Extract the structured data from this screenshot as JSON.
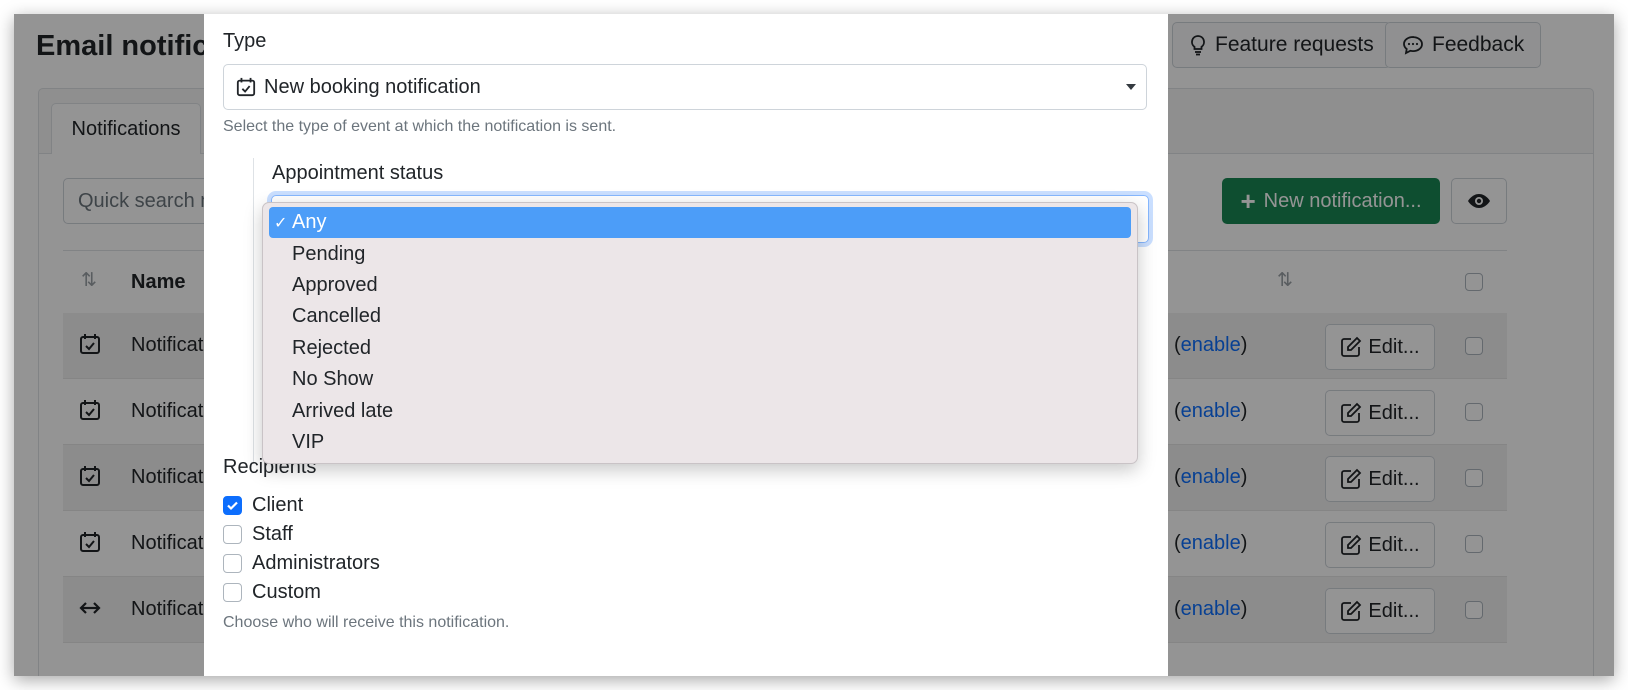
{
  "page": {
    "title": "Email notificat",
    "header_buttons": {
      "feature_requests": "Feature requests",
      "feedback": "Feedback"
    },
    "tabs": [
      {
        "label": "Notifications"
      }
    ],
    "search_placeholder": "Quick search n",
    "new_notification_label": "New notification...",
    "table": {
      "name_header": "Name",
      "rows": [
        {
          "name": "Notificat",
          "icon": "calendar-check-icon",
          "action_open": "(",
          "action_link": "enable",
          "action_close": ")",
          "edit_label": "Edit..."
        },
        {
          "name": "Notificat",
          "icon": "calendar-check-icon",
          "action_open": "(",
          "action_link": "enable",
          "action_close": ")",
          "edit_label": "Edit..."
        },
        {
          "name": "Notificat",
          "icon": "calendar-check-icon",
          "action_open": "(",
          "action_link": "enable",
          "action_close": ")",
          "edit_label": "Edit..."
        },
        {
          "name": "Notificat",
          "icon": "calendar-check-icon",
          "action_open": "(",
          "action_link": "enable",
          "action_close": ")",
          "edit_label": "Edit..."
        },
        {
          "name": "Notificat",
          "icon": "arrows-left-right-icon",
          "action_open": "(",
          "action_link": "enable",
          "action_close": ")",
          "edit_label": "Edit..."
        }
      ]
    }
  },
  "modal": {
    "type_label": "Type",
    "type_value": "New booking notification",
    "type_help": "Select the type of event at which the notification is sent.",
    "appointment_status_label": "Appointment status",
    "status_options": [
      {
        "label": "Any",
        "selected": true
      },
      {
        "label": "Pending",
        "selected": false
      },
      {
        "label": "Approved",
        "selected": false
      },
      {
        "label": "Cancelled",
        "selected": false
      },
      {
        "label": "Rejected",
        "selected": false
      },
      {
        "label": "No Show",
        "selected": false
      },
      {
        "label": "Arrived late",
        "selected": false
      },
      {
        "label": "VIP",
        "selected": false
      }
    ],
    "selected_check_glyph": "✓",
    "recipients_label": "Recipients",
    "recipients": [
      {
        "label": "Client",
        "checked": true
      },
      {
        "label": "Staff",
        "checked": false
      },
      {
        "label": "Administrators",
        "checked": false
      },
      {
        "label": "Custom",
        "checked": false
      }
    ],
    "recipients_help": "Choose who will receive this notification."
  },
  "colors": {
    "primary": "#0d6efd",
    "success": "#198754",
    "dropdown_selected": "#4c9df8",
    "dropdown_bg": "#ece6e8"
  }
}
